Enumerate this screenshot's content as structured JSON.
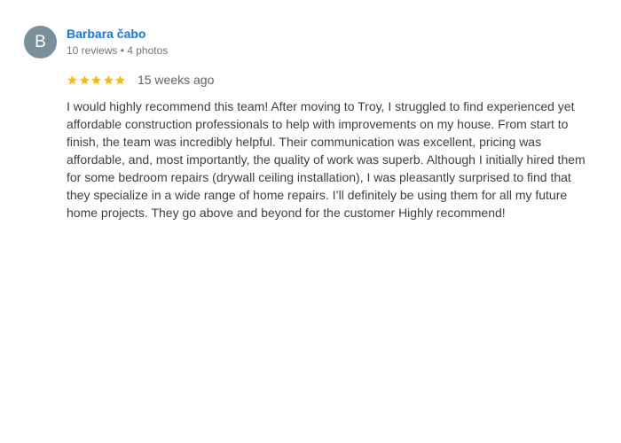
{
  "reviewer": {
    "avatar_letter": "B",
    "avatar_color": "#78909c",
    "name": "Barbara čabo",
    "meta": "10 reviews • 4 photos"
  },
  "rating": {
    "stars": 5,
    "max_stars": 5,
    "star_icon": "star-icon",
    "star_color": "#fbbc04",
    "date": "15 weeks ago"
  },
  "review": {
    "text": "I would highly recommend this team! After moving to Troy, I struggled to find experienced yet affordable construction professionals to help with improvements on my house. From start to finish, the team was incredibly helpful. Their communication was excellent, pricing was affordable, and, most importantly, the quality of work was superb. Although I initially hired them for some bedroom repairs (drywall ceiling installation), I was pleasantly surprised to find that they specialize in a wide range of home repairs. I’ll definitely be using them for all my future home projects. They go above and beyond for the customer Highly recommend!"
  }
}
